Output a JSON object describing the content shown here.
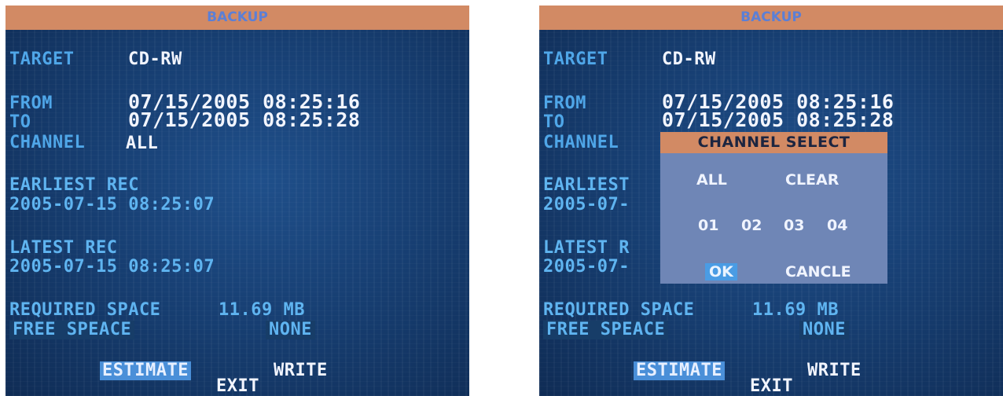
{
  "screen_left": {
    "title": "BACKUP",
    "target_label": "TARGET",
    "target_value": "CD-RW",
    "from_label": "FROM",
    "from_value": "07/15/2005 08:25:16",
    "to_label": "TO",
    "to_value": "07/15/2005 08:25:28",
    "channel_label": "CHANNEL",
    "channel_value": "ALL",
    "earliest_label": "EARLIEST REC",
    "earliest_value": "2005-07-15 08:25:07",
    "latest_label": "LATEST REC",
    "latest_value": "2005-07-15 08:25:07",
    "required_label": "REQUIRED SPACE",
    "required_value": "11.69 MB",
    "free_label": "FREE SPEACE",
    "free_value": "NONE",
    "estimate_button": "ESTIMATE",
    "write_button": "WRITE",
    "exit_button": "EXIT"
  },
  "screen_right": {
    "title": "BACKUP",
    "target_label": "TARGET",
    "target_value": "CD-RW",
    "from_label": "FROM",
    "from_value": "07/15/2005 08:25:16",
    "to_label": "TO",
    "to_value": "07/15/2005 08:25:28",
    "channel_label": "CHANNEL",
    "earliest_label_partial": "EARLIEST",
    "earliest_value_partial": "2005-07-",
    "latest_label_partial": "LATEST R",
    "latest_value_partial": "2005-07-",
    "required_label": "REQUIRED SPACE",
    "required_value": "11.69 MB",
    "free_label": "FREE SPEACE",
    "free_value": "NONE",
    "estimate_button": "ESTIMATE",
    "write_button": "WRITE",
    "exit_button": "EXIT",
    "popup": {
      "title": "CHANNEL SELECT",
      "all_button": "ALL",
      "clear_button": "CLEAR",
      "channels": [
        "01",
        "02",
        "03",
        "04"
      ],
      "ok_button": "OK",
      "cancel_button": "CANCLE"
    }
  },
  "colors": {
    "title_bar": "#d28a64",
    "background": "#173f73",
    "label_text": "#4fa6e8",
    "value_text": "#f2f5ff",
    "popup_bg": "#6f86b6",
    "selection": "#4a8fd8"
  }
}
